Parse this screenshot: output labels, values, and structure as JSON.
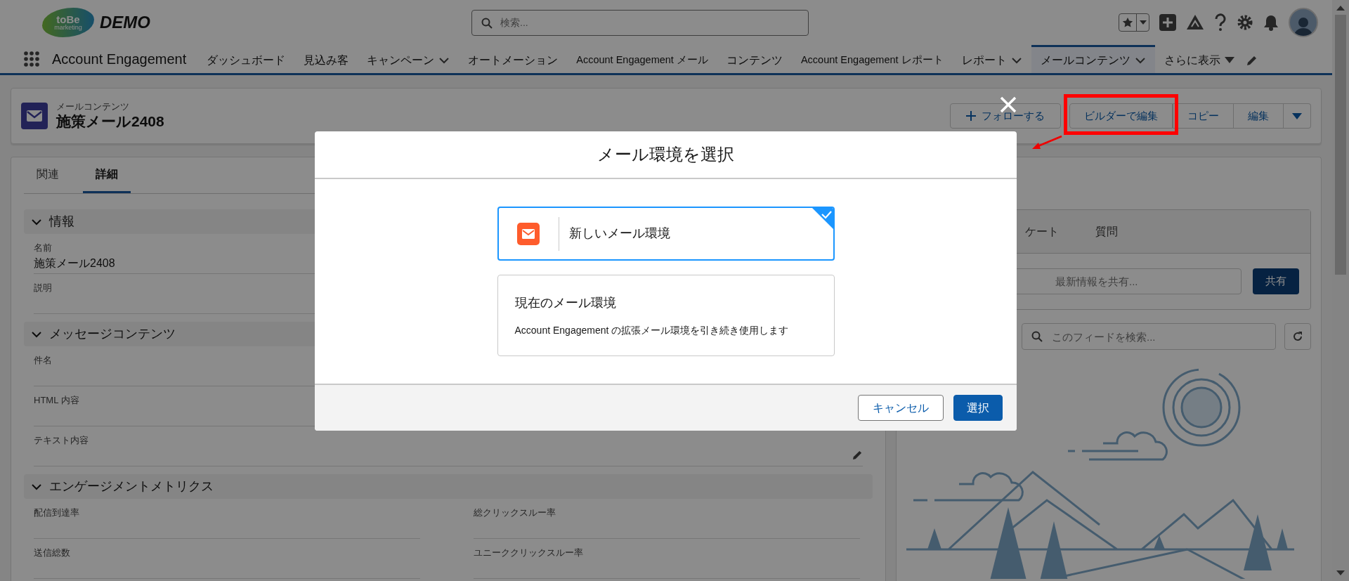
{
  "header": {
    "logo_mark": "toBe",
    "logo_tagline": "marketing",
    "logo_text": "DEMO",
    "search": {
      "placeholder": "検索..."
    }
  },
  "app_nav": {
    "app_name": "Account Engagement",
    "items": [
      {
        "label": "ダッシュボード",
        "has_menu": false,
        "selected": false
      },
      {
        "label": "見込み客",
        "has_menu": false,
        "selected": false
      },
      {
        "label": "キャンペーン",
        "has_menu": true,
        "selected": false
      },
      {
        "label": "オートメーション",
        "has_menu": false,
        "selected": false
      },
      {
        "label": "Account Engagement メール",
        "has_menu": false,
        "selected": false
      },
      {
        "label": "コンテンツ",
        "has_menu": false,
        "selected": false
      },
      {
        "label": "Account Engagement レポート",
        "has_menu": false,
        "selected": false
      },
      {
        "label": "レポート",
        "has_menu": true,
        "selected": false
      },
      {
        "label": "メールコンテンツ",
        "has_menu": true,
        "selected": true
      }
    ],
    "more": "さらに表示"
  },
  "record": {
    "object_label": "メールコンテンツ",
    "title": "施策メール2408",
    "actions": [
      {
        "label": "フォローする",
        "kind": "follow",
        "highlighted": false
      },
      {
        "label": "ビルダーで編集",
        "kind": "plain",
        "highlighted": true
      },
      {
        "label": "コピー",
        "kind": "plain",
        "highlighted": false
      },
      {
        "label": "編集",
        "kind": "plain",
        "highlighted": false
      }
    ]
  },
  "detail_tabs": [
    {
      "label": "関連",
      "selected": false
    },
    {
      "label": "詳細",
      "selected": true
    }
  ],
  "sections": [
    {
      "title": "情報",
      "expanded": true,
      "kind": "list",
      "fields": [
        {
          "label": "名前",
          "value": "施策メール2408",
          "editable": false
        },
        {
          "label": "説明",
          "editable": false
        }
      ]
    },
    {
      "title": "メッセージコンテンツ",
      "expanded": true,
      "kind": "list",
      "fields": [
        {
          "label": "件名",
          "editable": false
        },
        {
          "label": "HTML 内容",
          "editable": false
        },
        {
          "label": "テキスト内容",
          "editable": true
        }
      ]
    },
    {
      "title": "エンゲージメントメトリクス",
      "expanded": true,
      "kind": "grid",
      "fields": [
        {
          "label": "配信到達率",
          "editable": false
        },
        {
          "label": "総クリックスルー率",
          "editable": false
        },
        {
          "label": "送信総数",
          "editable": false
        },
        {
          "label": "ユニーククリックスルー率",
          "editable": false
        }
      ]
    }
  ],
  "feed": {
    "tabs": [
      "ケート",
      "質問"
    ],
    "share_placeholder": "最新情報を共有...",
    "share_button": "共有",
    "search_placeholder": "このフィードを検索..."
  },
  "modal": {
    "title": "メール環境を選択",
    "options": [
      {
        "kind": "icon",
        "title": "新しいメール環境",
        "selected": true
      },
      {
        "kind": "text",
        "title": "現在のメール環境",
        "description": "Account Engagement の拡張メール環境を引き続き使用します",
        "selected": false
      }
    ],
    "buttons": [
      {
        "label": "キャンセル",
        "kind": "neutral"
      },
      {
        "label": "選択",
        "kind": "brand"
      }
    ]
  }
}
